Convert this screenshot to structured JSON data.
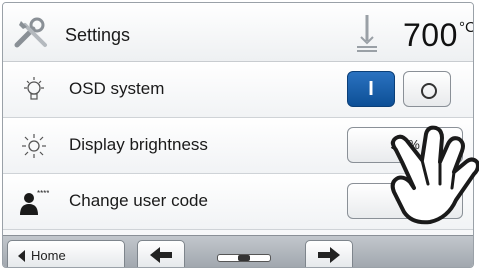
{
  "header": {
    "title": "Settings",
    "temperature_value": "700",
    "temperature_unit": "°C"
  },
  "rows": [
    {
      "label": "OSD system",
      "icon": "bulb-icon",
      "toggle_on_label": "I",
      "toggle_off_label": "O",
      "state": "on"
    },
    {
      "label": "Display brightness",
      "icon": "sun-icon",
      "value": "90 %"
    },
    {
      "label": "Change user code",
      "icon": "user-code-icon",
      "value": "****"
    }
  ],
  "footer": {
    "home_label": "Home",
    "back_icon": "arrow-left-icon",
    "forward_icon": "arrow-right-icon",
    "page_indicator_icon": "page-slider-icon"
  },
  "colors": {
    "accent": "#0d4f96",
    "footer": "#aab0b6"
  }
}
